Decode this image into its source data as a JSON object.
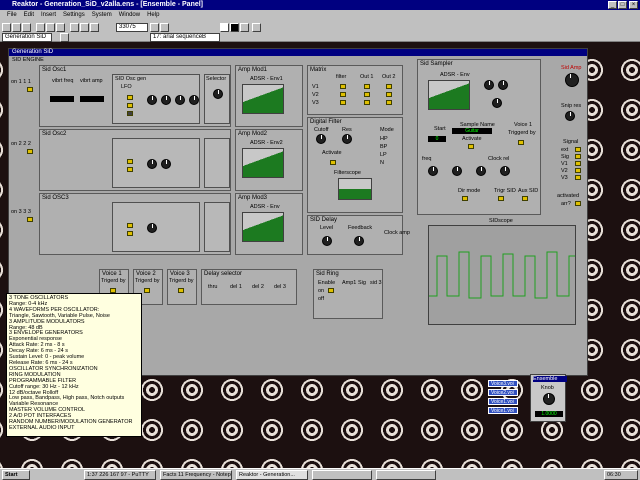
{
  "window": {
    "title": "Reaktor - Generation_SiD_v2alla.ens - [Ensemble - Panel]",
    "min": "_",
    "max": "□",
    "close": "×"
  },
  "menu": [
    "File",
    "Edit",
    "Insert",
    "Settings",
    "System",
    "Window",
    "Help"
  ],
  "toolbar": {
    "rate": "33075",
    "instrument": "Generation SiD",
    "preset": "17: arial sequenceB"
  },
  "panel": {
    "title": "Generation SiD",
    "engine": "SID ENGINE"
  },
  "osc": [
    {
      "title": "Sid Osc1",
      "on": "on 1 1 1",
      "sync": "sync"
    },
    {
      "title": "Sid Osc2",
      "on": "on 2 2 2",
      "sync": "sync"
    },
    {
      "title": "Sid OSC3",
      "on": "on 3 3 3",
      "sync": "sync"
    }
  ],
  "osc_labels": {
    "vibrfreq": "vibrt freq",
    "vibramp": "vibrt amp",
    "gen": "SID Osc gen",
    "lfo": "LFO",
    "sel": "Selector",
    "tri": "Tri",
    "saw": "Saw",
    "pulse": "Pulse",
    "noise": "Noise",
    "shape": "Shape",
    "rate": "Rate",
    "amnt": "Amnt",
    "fine": "Fine",
    "sync": "Sync",
    "tune": "Tune"
  },
  "amp": [
    {
      "title": "Amp Mod1",
      "env": "ADSR - Env1"
    },
    {
      "title": "Amp Mod2",
      "env": "ADSR - Env2"
    },
    {
      "title": "Amp Mod3",
      "env": "ADSR - Env"
    }
  ],
  "matrix": {
    "title": "Matrix",
    "cols": [
      "filter",
      "Out 1",
      "Out 2"
    ],
    "rows": [
      "V1",
      "V2",
      "V3"
    ]
  },
  "filter": {
    "title": "Digital Filter",
    "cutoff": "Cutoff",
    "res": "Res",
    "mode": "Mode",
    "modes": [
      "HP",
      "BP",
      "LP",
      "N"
    ],
    "activate": "Activate",
    "onoff": "On",
    "fscope": "Filterscope"
  },
  "delay": {
    "title": "SID Delay",
    "level": "Level",
    "feedback": "Feedback",
    "clock": "Clock amp"
  },
  "sampler": {
    "title": "Sid Sampler",
    "env": "ADSR - Env",
    "sample": "Sample Name",
    "guitar": "Guitar",
    "start": "Start",
    "startval": "0",
    "voice": "Voice 1",
    "trig": "Triggerd by",
    "freq": "freq",
    "clkrel": "Clock rel",
    "activate": "Activate",
    "dirmode": "Dir mode",
    "trigsid": "Trigr SID",
    "aux": "Aux SID"
  },
  "right": {
    "sidamp": "Sid Amp",
    "sidres": "Snip res",
    "signal": "Signal",
    "sigrows": [
      "ext",
      "Sig",
      "V1",
      "V2",
      "V3"
    ],
    "activated": "activated",
    "arr": "arr?"
  },
  "scope": {
    "title": "SIDscope"
  },
  "voices": [
    {
      "title": "Voice 1",
      "trig": "Trigerd by"
    },
    {
      "title": "Voice 2",
      "trig": "Trigerd by"
    },
    {
      "title": "Voice 3",
      "trig": "Trigerd by"
    }
  ],
  "delaysel": {
    "title": "Delay selector",
    "slots": [
      "thru",
      "del 1",
      "del 2",
      "del 3"
    ]
  },
  "ring": {
    "title": "Sid Ring",
    "enable": "Enable",
    "on": "on",
    "off": "off",
    "labels": [
      "Amp1",
      "Sig",
      "sid 3"
    ]
  },
  "info": [
    "3 TONE OSCILLATORS",
    "Range: 0-4 kHz",
    "4 WAVEFORMS PER OSCILLATOR:",
    "Triangle, Sawtooth, Variable Pulse, Noise",
    "3 AMPLITUDE MODULATORS",
    "Range: 48 dB",
    "3 ENVELOPE GENERATORS",
    "Exponential response",
    "Attack Rate: 2 ms - 8 s",
    "Decay Rate: 6 ms - 24 s",
    "Sustain Level: 0 - peak volume",
    "Release Rate: 6 ms - 24 s",
    "OSCILLATOR SYNCHRONIZATION",
    "RING MODULATION",
    "PROGRAMMABLE FILTER",
    "Cutoff range: 30 Hz - 12 kHz",
    "12 dB/octave Rolloff",
    "Low pass, Bandpass, High pass, Notch outputs",
    "Variable Resonance",
    "MASTER VOLUME CONTROL",
    "2 A/D POT INTERFACES",
    "RANDOM NUMBER/MODULATION GENERATOR",
    "EXTERNAL AUDIO INPUT"
  ],
  "voicebtns": [
    "Voice3.voi",
    "Voice2.voi",
    "Voice1.voi",
    "Voice1.voi"
  ],
  "ensemble": {
    "title": "Ensemble",
    "knob": "Knob",
    "val": "1.0000"
  },
  "taskbar": {
    "start": "Start",
    "tasks": [
      "1:37 226 167 97 - PuTTY",
      "Facts 11 Frequency - Notep",
      "Reaktor - Generation...",
      "",
      ""
    ],
    "clock": "06:30"
  }
}
